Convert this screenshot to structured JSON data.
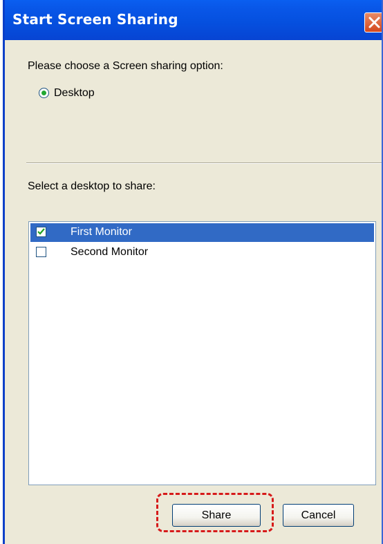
{
  "window": {
    "title": "Start Screen Sharing"
  },
  "sharing_option": {
    "prompt": "Please choose a Screen sharing option:",
    "options": [
      {
        "label": "Desktop",
        "selected": true
      }
    ]
  },
  "desktop_select": {
    "prompt": "Select a desktop to share:",
    "items": [
      {
        "label": "First Monitor",
        "checked": true,
        "highlighted": true
      },
      {
        "label": "Second Monitor",
        "checked": false,
        "highlighted": false
      }
    ]
  },
  "buttons": {
    "share_label": "Share",
    "cancel_label": "Cancel"
  },
  "colors": {
    "titlebar": "#0550df",
    "selection": "#316ac5",
    "annotation": "#d61a1a"
  },
  "icons": {
    "close": "close-icon",
    "check": "checkmark-icon"
  }
}
